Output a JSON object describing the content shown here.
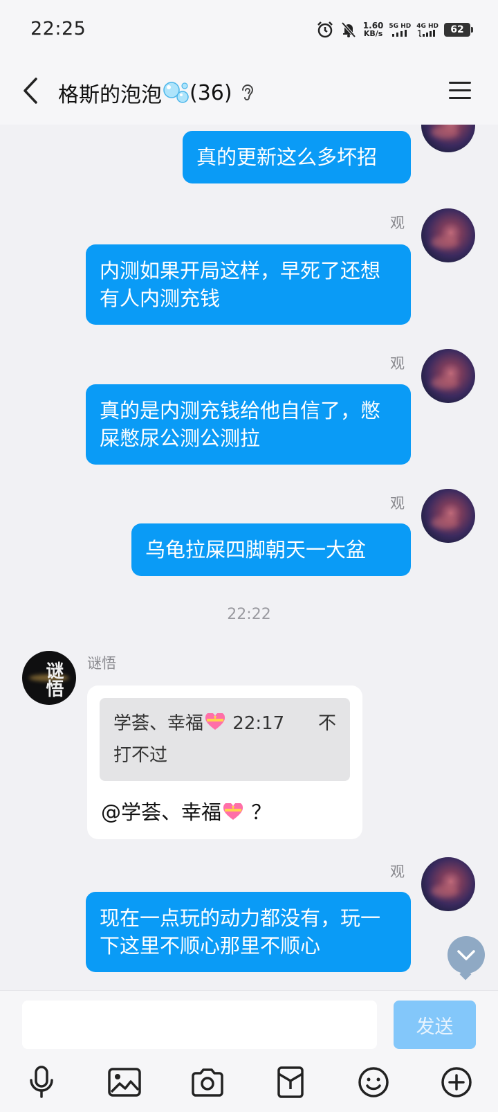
{
  "status_bar": {
    "time": "22:25",
    "speed_value": "1.60",
    "speed_unit": "KB/s",
    "net1": "5G HD",
    "net2": "4G HD",
    "battery": "62"
  },
  "header": {
    "title": "格斯的泡泡",
    "member_count": "(36)"
  },
  "messages": [
    {
      "side": "right",
      "sender": "",
      "text": "真的更新这么多坏招"
    },
    {
      "side": "right",
      "sender": "观",
      "text": "内测如果开局这样，早死了还想有人内测充钱"
    },
    {
      "side": "right",
      "sender": "观",
      "text": "真的是内测充钱给他自信了，憋屎憋尿公测公测拉"
    },
    {
      "side": "right",
      "sender": "观",
      "text": "乌龟拉屎四脚朝天一大盆"
    },
    {
      "side": "left",
      "sender": "谜悟",
      "avatar_text": "谜悟",
      "quote": {
        "author": "学荟、幸福",
        "time": "22:17",
        "text_part1": "不",
        "text_part2": "打不过"
      },
      "text": "@学荟、幸福",
      "text_suffix": "？"
    },
    {
      "side": "right",
      "sender": "观",
      "text": "现在一点玩的动力都没有，玩一下这里不顺心那里不顺心"
    }
  ],
  "timestamp": "22:22",
  "input": {
    "placeholder": "",
    "value": "",
    "send_label": "发送"
  },
  "toolbar": [
    "microphone-icon",
    "image-icon",
    "camera-icon",
    "red-packet-icon",
    "emoji-icon",
    "plus-icon"
  ],
  "colors": {
    "bubble_right": "#0a9bf6",
    "send_disabled": "#83c7fa"
  }
}
